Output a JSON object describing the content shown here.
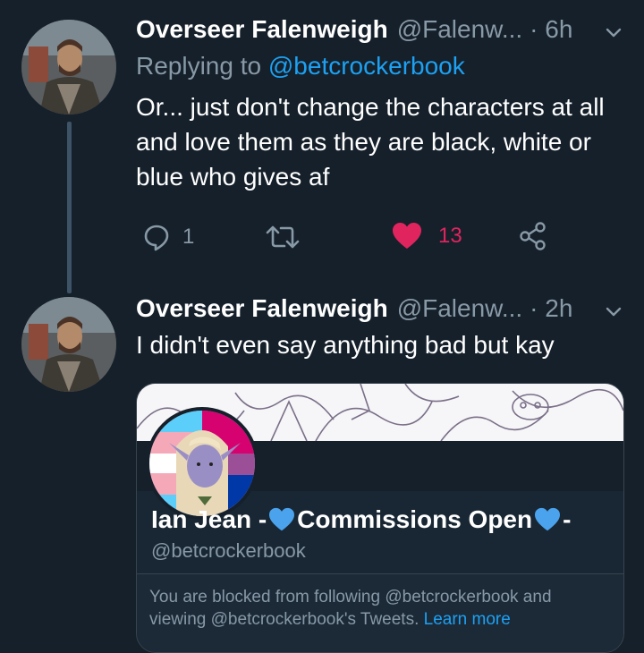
{
  "tweet1": {
    "name": "Overseer Falenweigh",
    "handle": "@Falenw...",
    "time": "· 6h",
    "replying_label": "Replying to",
    "replying_handle": "@betcrockerbook",
    "text": "Or... just don't change the characters at all and love them as they are black, white or blue who gives af",
    "reply_count": "1",
    "retweet_count": "",
    "like_count": "13"
  },
  "tweet2": {
    "name": "Overseer Falenweigh",
    "handle": "@Falenw...",
    "time": "· 2h",
    "text": "I didn't even say anything bad but kay"
  },
  "card": {
    "name_prefix": "Ian Jean -",
    "name_middle": "Commissions Open",
    "name_suffix": "-",
    "handle": "@betcrockerbook",
    "blocked_text": "You are blocked from following @betcrockerbook and viewing @betcrockerbook's Tweets.",
    "learn_more": "Learn more"
  },
  "colors": {
    "background": "#15202b",
    "link": "#1da1f2",
    "like": "#e0245e",
    "muted": "#8899a6"
  },
  "icons": [
    "reply-icon",
    "retweet-icon",
    "heart-icon",
    "share-icon",
    "chevron-down-icon",
    "blue-heart-icon"
  ]
}
